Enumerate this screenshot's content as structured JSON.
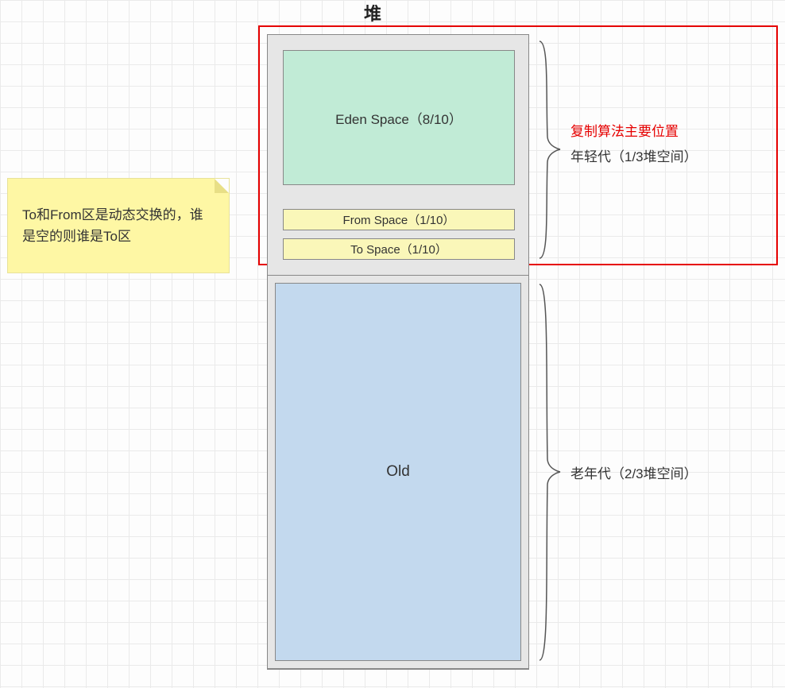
{
  "title": "堆",
  "heap": {
    "eden_label": "Eden Space（8/10）",
    "from_label": "From Space（1/10）",
    "to_label": "To Space（1/10）",
    "old_label": "Old"
  },
  "note_text": "To和From区是动态交换的，谁是空的则谁是To区",
  "young_gen": {
    "red_line": "复制算法主要位置",
    "black_line": "年轻代（1/3堆空间）"
  },
  "old_gen_label": "老年代（2/3堆空间）"
}
